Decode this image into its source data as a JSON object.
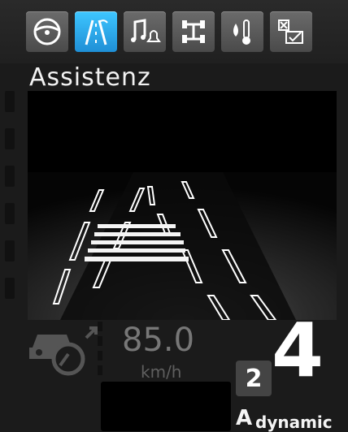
{
  "tabs": [
    {
      "name": "steering-wheel-icon",
      "active": false
    },
    {
      "name": "lane-assist-icon",
      "active": true
    },
    {
      "name": "audio-alert-icon",
      "active": false
    },
    {
      "name": "chassis-icon",
      "active": false
    },
    {
      "name": "fluid-temperature-icon",
      "active": false
    },
    {
      "name": "settings-checklist-icon",
      "active": false
    }
  ],
  "screen": {
    "title": "Assistenz"
  },
  "status": {
    "speed": "85.0",
    "speed_unit": "km/h",
    "gear_small": "2",
    "gear_large": "4",
    "drive_mode_letter": "A",
    "drive_mode_label": "dynamic"
  },
  "colors": {
    "accent": "#2aa8f0",
    "background": "#1b1b1b",
    "lane_marking": "#ffffff"
  }
}
